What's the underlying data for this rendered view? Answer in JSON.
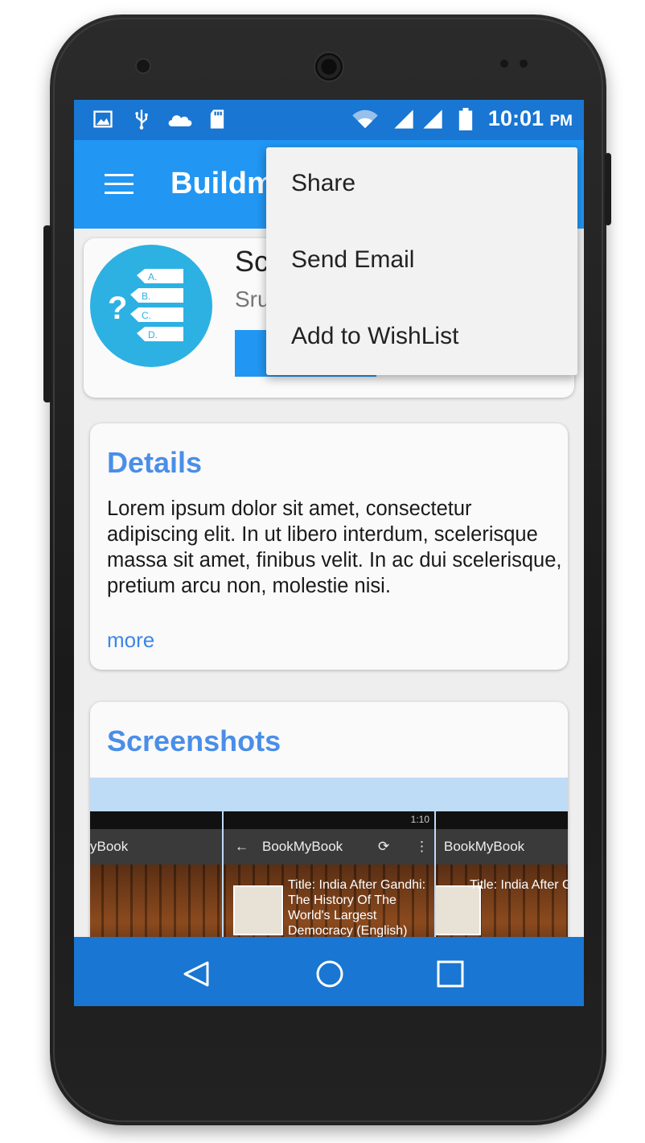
{
  "status_bar": {
    "time": "10:01",
    "ampm": "PM",
    "icons": [
      "image-icon",
      "usb-icon",
      "cloud-icon",
      "sd-card-icon",
      "wifi-icon",
      "signal-icon",
      "signal-icon",
      "battery-icon"
    ]
  },
  "app_bar": {
    "title": "Buildm",
    "menu_icon": "hamburger-icon"
  },
  "app_card": {
    "name": "Sc",
    "developer": "Sru",
    "logo_labels": [
      "?",
      "A.",
      "B.",
      "C.",
      "D."
    ]
  },
  "details": {
    "title": "Details",
    "body": "Lorem ipsum dolor sit amet, consectetur adipiscing elit. In ut libero interdum, scelerisque massa sit amet, finibus velit. In ac dui scelerisque, pretium arcu non, molestie nisi.",
    "more": "more"
  },
  "screenshots": {
    "title": "Screenshots",
    "items": [
      {
        "bar_title": "yBook",
        "status": "",
        "book_text": ""
      },
      {
        "bar_title": "BookMyBook",
        "status": "1:10",
        "book_text": "Title: India After Gandhi: The History Of The World's Largest Democracy (English)"
      },
      {
        "bar_title": "BookMyBook",
        "status": "",
        "book_text": "Title: India After Gandhi: The Histo The World's Large Democracy (Engl"
      }
    ]
  },
  "overflow_menu": {
    "items": [
      "Share",
      "Send Email",
      "Add to WishList"
    ]
  },
  "nav_bar": {
    "icons": [
      "back-icon",
      "home-icon",
      "recents-icon"
    ]
  },
  "colors": {
    "status_bar": "#1976d2",
    "app_bar": "#2196f3",
    "accent_title": "#4a8ee8",
    "link": "#3d86e6"
  }
}
